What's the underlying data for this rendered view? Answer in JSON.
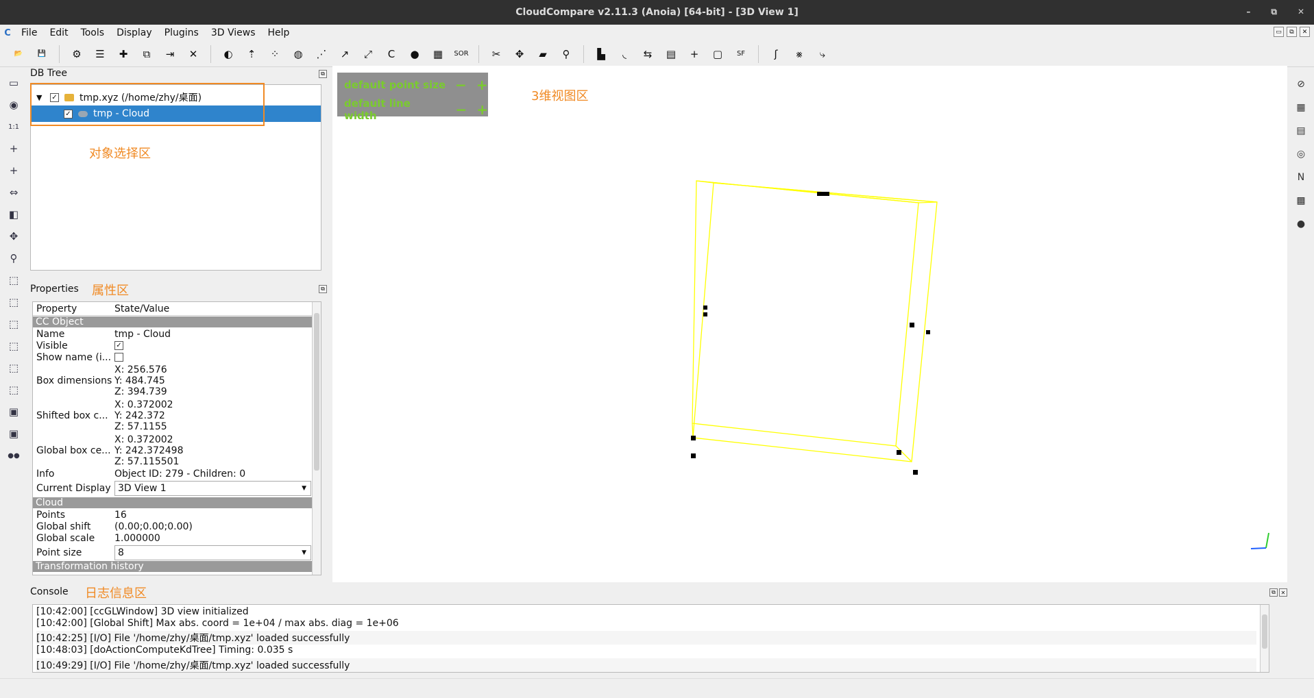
{
  "window": {
    "title": "CloudCompare v2.11.3 (Anoia) [64-bit] - [3D View 1]",
    "controls": [
      "–",
      "⧉",
      "✕"
    ]
  },
  "menu": {
    "logo": "C",
    "items": [
      "File",
      "Edit",
      "Tools",
      "Display",
      "Plugins",
      "3D Views",
      "Help"
    ],
    "mdi_controls": [
      "▭",
      "⧉",
      "✕"
    ]
  },
  "toolbar": {
    "buttons": [
      {
        "icon": "open-icon",
        "glyph": "📂"
      },
      {
        "icon": "save-icon",
        "glyph": "💾"
      },
      {
        "icon": "gear-move-icon",
        "glyph": "⚙"
      },
      {
        "icon": "list-icon",
        "glyph": "☰"
      },
      {
        "icon": "merge-icon",
        "glyph": "✚"
      },
      {
        "icon": "clone-icon",
        "glyph": "⧉"
      },
      {
        "icon": "subsample-icon",
        "glyph": "⇥"
      },
      {
        "icon": "delete-icon",
        "glyph": "✕"
      },
      {
        "icon": "color-icon",
        "glyph": "◐"
      },
      {
        "icon": "normal-icon",
        "glyph": "⇡"
      },
      {
        "icon": "sample-icon",
        "glyph": "⁘"
      },
      {
        "icon": "mesh-icon",
        "glyph": "◍"
      },
      {
        "icon": "segment-icon",
        "glyph": "⋰"
      },
      {
        "icon": "align-icon",
        "glyph": "↗"
      },
      {
        "icon": "register-icon",
        "glyph": "⤢"
      },
      {
        "icon": "ccc-icon",
        "glyph": "C"
      },
      {
        "icon": "bunny-icon",
        "glyph": "●"
      },
      {
        "icon": "checker-icon",
        "glyph": "▦"
      },
      {
        "icon": "sor-icon",
        "glyph": "SOR"
      },
      {
        "icon": "cut-icon",
        "glyph": "✂"
      },
      {
        "icon": "translate-icon",
        "glyph": "✥"
      },
      {
        "icon": "plane-icon",
        "glyph": "▰"
      },
      {
        "icon": "pick-icon",
        "glyph": "⚲"
      },
      {
        "icon": "histogram-icon",
        "glyph": "▙"
      },
      {
        "icon": "curve-icon",
        "glyph": "◟"
      },
      {
        "icon": "minmax-icon",
        "glyph": "⇆"
      },
      {
        "icon": "table-icon",
        "glyph": "▤"
      },
      {
        "icon": "plus-icon",
        "glyph": "+"
      },
      {
        "icon": "calc-icon",
        "glyph": "▢"
      },
      {
        "icon": "sf-icon",
        "glyph": "SF"
      },
      {
        "icon": "s-curve-icon",
        "glyph": "ʃ"
      },
      {
        "icon": "sf-filter-icon",
        "glyph": "⨳"
      },
      {
        "icon": "export-icon",
        "glyph": "⤷"
      }
    ]
  },
  "left_toolbar": [
    {
      "icon": "screen-icon",
      "glyph": "▭"
    },
    {
      "icon": "camera-icon",
      "glyph": "◉"
    },
    {
      "icon": "one-to-one-icon",
      "glyph": "1:1"
    },
    {
      "icon": "pivot-icon",
      "glyph": "+"
    },
    {
      "icon": "auto-pivot-icon",
      "glyph": "+"
    },
    {
      "icon": "rotate-icon",
      "glyph": "⇔"
    },
    {
      "icon": "cube-icon",
      "glyph": "◧"
    },
    {
      "icon": "move-icon",
      "glyph": "✥"
    },
    {
      "icon": "zoom-icon",
      "glyph": "⚲"
    },
    {
      "icon": "view-top-icon",
      "glyph": "⬚"
    },
    {
      "icon": "view-front-icon",
      "glyph": "⬚"
    },
    {
      "icon": "view-left-icon",
      "glyph": "⬚"
    },
    {
      "icon": "view-back-icon",
      "glyph": "⬚"
    },
    {
      "icon": "view-right-icon",
      "glyph": "⬚"
    },
    {
      "icon": "view-bottom-icon",
      "glyph": "⬚"
    },
    {
      "icon": "front-label-icon",
      "glyph": "▣"
    },
    {
      "icon": "back-label-icon",
      "glyph": "▣"
    },
    {
      "icon": "stereo-icon",
      "glyph": "●●"
    }
  ],
  "right_toolbar": [
    {
      "icon": "no-entry-icon",
      "glyph": "⊘"
    },
    {
      "icon": "col-icon",
      "glyph": "▦"
    },
    {
      "icon": "clapper-icon",
      "glyph": "▤"
    },
    {
      "icon": "compass-icon",
      "glyph": "◎"
    },
    {
      "icon": "north-icon",
      "glyph": "N"
    },
    {
      "icon": "rgb-icon",
      "glyph": "▩"
    },
    {
      "icon": "rgb-sphere-icon",
      "glyph": "●"
    }
  ],
  "dbtree": {
    "title": "DB Tree",
    "rows": [
      {
        "label": "tmp.xyz (/home/zhy/桌面)",
        "checked": "✓"
      },
      {
        "label": "tmp - Cloud",
        "checked": "✓"
      }
    ],
    "annotation": "对象选择区"
  },
  "properties": {
    "title": "Properties",
    "annotation": "属性区",
    "headers": [
      "Property",
      "State/Value"
    ],
    "section_cc": "CC Object",
    "section_cloud": "Cloud",
    "section_transform": "Transformation history",
    "name_key": "Name",
    "name_val": "tmp - Cloud",
    "visible_key": "Visible",
    "visible_val": "✓",
    "showname_key": "Show name (i...",
    "boxdim_key": "Box dimensions",
    "boxdim": [
      "X: 256.576",
      "Y: 484.745",
      "Z: 394.739"
    ],
    "shifted_key": "Shifted box c...",
    "shifted": [
      "X: 0.372002",
      "Y: 242.372",
      "Z: 57.1155"
    ],
    "global_key": "Global box ce...",
    "global": [
      "X: 0.372002",
      "Y: 242.372498",
      "Z: 57.115501"
    ],
    "info_key": "Info",
    "info_val": "Object ID: 279 - Children: 0",
    "display_key": "Current Display",
    "display_val": "3D View 1",
    "points_key": "Points",
    "points_val": "16",
    "gshift_key": "Global shift",
    "gshift_val": "(0.00;0.00;0.00)",
    "gscale_key": "Global scale",
    "gscale_val": "1.000000",
    "psize_key": "Point size",
    "psize_val": "8"
  },
  "view3d": {
    "annotation": "3维视图区",
    "overlay": {
      "point_size_label": "default point size",
      "line_width_label": "default line width",
      "minus": "−",
      "plus": "+"
    },
    "colors": {
      "bbox": "#ffff00",
      "points": "#000000",
      "axis_green": "#2ecc2e",
      "axis_blue": "#2060ff"
    }
  },
  "console": {
    "title": "Console",
    "annotation": "日志信息区",
    "lines": [
      "[10:42:00] [ccGLWindow] 3D view initialized",
      "[10:42:00] [Global Shift] Max abs. coord = 1e+04 / max abs. diag = 1e+06",
      "[10:42:25] [I/O] File '/home/zhy/桌面/tmp.xyz' loaded successfully",
      "[10:48:03] [doActionComputeKdTree] Timing: 0.035 s",
      "[10:49:29] [I/O] File '/home/zhy/桌面/tmp.xyz' loaded successfully"
    ]
  },
  "accent": "#f08a24",
  "selection": "#2f84cc"
}
